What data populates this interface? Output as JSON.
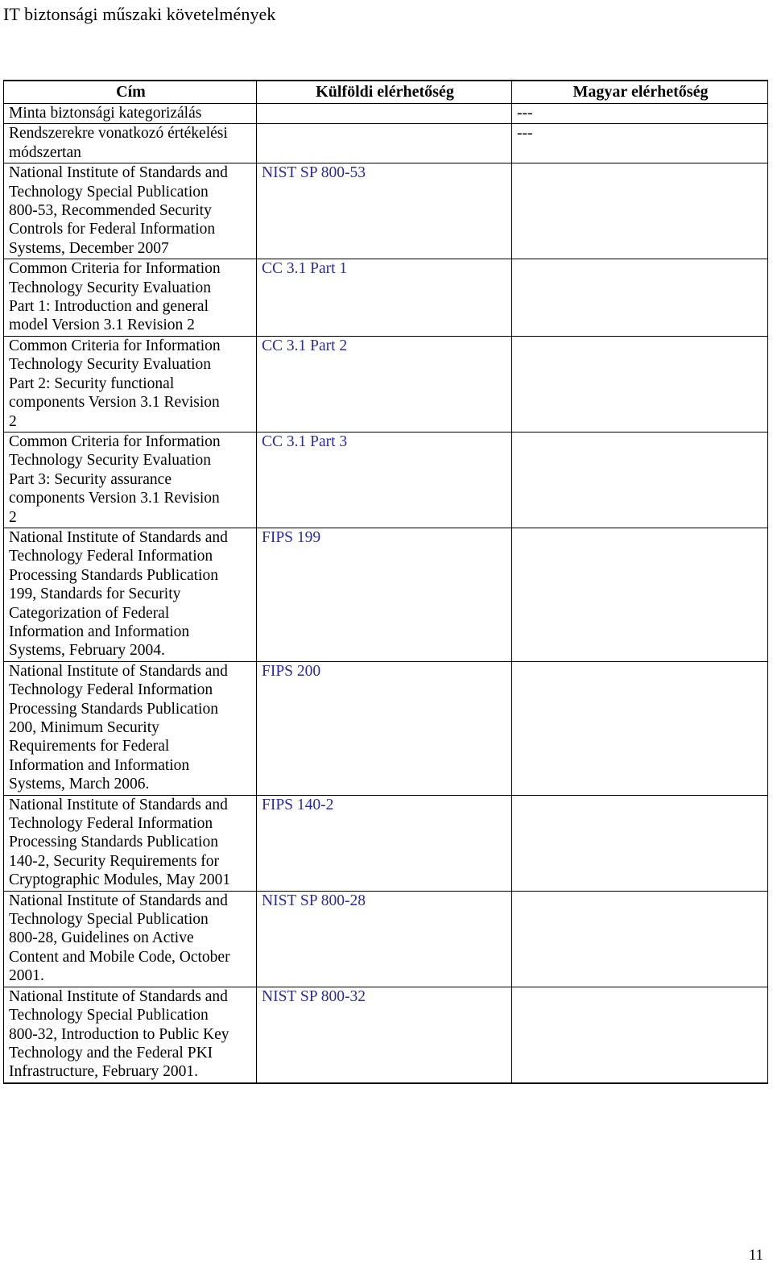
{
  "document": {
    "running_head": "IT biztonsági műszaki követelmények",
    "page_number": "11"
  },
  "table": {
    "columns": [
      {
        "id": "title",
        "label": "Cím"
      },
      {
        "id": "foreign",
        "label": "Külföldi elérhetőség"
      },
      {
        "id": "hun",
        "label": "Magyar elérhetőség"
      }
    ],
    "rows": [
      {
        "title": "Minta biztonsági kategorizálás",
        "foreign": "",
        "hun": "---"
      },
      {
        "title": "Rendszerekre vonatkozó értékelési\nmódszertan",
        "foreign": "",
        "hun": "---"
      },
      {
        "title": "National Institute of Standards and\nTechnology Special Publication\n800-53, Recommended Security\nControls for Federal Information\nSystems, December 2007",
        "foreign": "NIST SP 800-53",
        "hun": ""
      },
      {
        "title": "Common Criteria for Information\nTechnology Security Evaluation\nPart 1: Introduction and general\nmodel Version 3.1 Revision 2",
        "foreign": "CC 3.1 Part 1",
        "hun": ""
      },
      {
        "title": "Common Criteria for Information\nTechnology Security Evaluation\nPart 2: Security functional\ncomponents Version 3.1 Revision\n2",
        "foreign": "CC 3.1 Part 2",
        "hun": ""
      },
      {
        "title": "Common Criteria for Information\nTechnology Security Evaluation\nPart 3: Security assurance\ncomponents Version 3.1 Revision\n2",
        "foreign": "CC 3.1 Part 3",
        "hun": ""
      },
      {
        "title": "National Institute of Standards and\nTechnology Federal Information\nProcessing Standards Publication\n199, Standards for Security\nCategorization of Federal\nInformation and Information\nSystems, February 2004.",
        "foreign": "FIPS 199",
        "hun": ""
      },
      {
        "title": "National Institute of Standards and\nTechnology Federal Information\nProcessing Standards Publication\n200, Minimum Security\nRequirements for Federal\nInformation and Information\nSystems, March 2006.",
        "foreign": "FIPS 200",
        "hun": ""
      },
      {
        "title": "National Institute of Standards and\nTechnology Federal Information\nProcessing Standards Publication\n140-2, Security Requirements for\nCryptographic Modules, May 2001",
        "foreign": "FIPS 140-2",
        "hun": ""
      },
      {
        "title": "National Institute of Standards and\nTechnology Special Publication\n800-28, Guidelines on Active\nContent and Mobile Code, October\n2001.",
        "foreign": "NIST SP 800-28",
        "hun": ""
      },
      {
        "title": "National Institute of Standards and\nTechnology Special Publication\n800-32, Introduction to Public Key\nTechnology and the Federal PKI\nInfrastructure, February 2001.",
        "foreign": "NIST SP 800-32",
        "hun": ""
      }
    ]
  },
  "colors": {
    "link_blue": "#2A2AA5",
    "text_black": "#000000",
    "rule": "#000000"
  }
}
